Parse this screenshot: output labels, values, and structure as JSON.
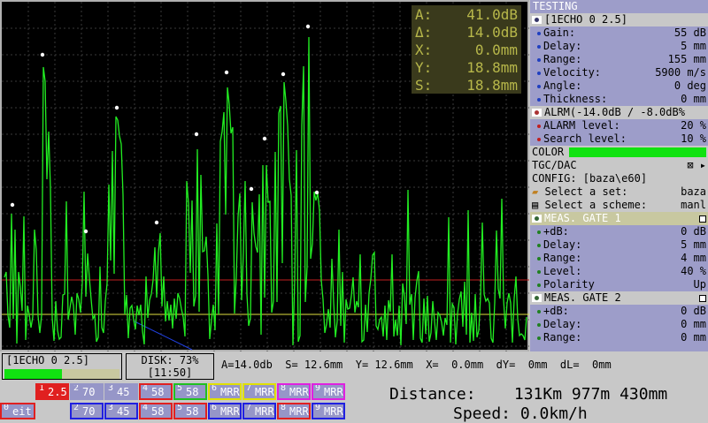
{
  "readout": [
    {
      "label": "A:",
      "value": "41.0dB"
    },
    {
      "label": "Δ:",
      "value": "14.0dB"
    },
    {
      "label": "X:",
      "value": "0.0mm"
    },
    {
      "label": "Y:",
      "value": "18.8mm"
    },
    {
      "label": "S:",
      "value": "18.8mm"
    }
  ],
  "panel": {
    "title": "TESTING",
    "echo_header": "[1ECHO 0 2.5]",
    "echo_items": [
      {
        "label": "Gain:",
        "value": "55 dB"
      },
      {
        "label": "Delay:",
        "value": "5 mm"
      },
      {
        "label": "Range:",
        "value": "155 mm"
      },
      {
        "label": "Velocity:",
        "value": "5900 m/s"
      },
      {
        "label": "Angle:",
        "value": "0 deg"
      },
      {
        "label": "Thickness:",
        "value": "0 mm"
      }
    ],
    "alarm_header": "ALRM(-14.0dB / -8.0dB%",
    "alarm_items": [
      {
        "label": "ALARM level:",
        "value": "20 %"
      },
      {
        "label": "Search level:",
        "value": "10 %"
      }
    ],
    "color_label": "COLOR",
    "tgc_label": "TGC/DAC",
    "config_label": "CONFIG: [baza\\e60]",
    "select_set": {
      "label": "Select a set:",
      "value": "baza"
    },
    "select_scheme": {
      "label": "Select a scheme:",
      "value": "manl"
    },
    "gate1_header": "MEAS. GATE 1",
    "gate1_items": [
      {
        "label": "+dB:",
        "value": "0 dB"
      },
      {
        "label": "Delay:",
        "value": "5 mm"
      },
      {
        "label": "Range:",
        "value": "4 mm"
      },
      {
        "label": "Level:",
        "value": "40 %"
      },
      {
        "label": "Polarity",
        "value": "Up"
      }
    ],
    "gate2_header": "MEAS. GATE 2",
    "gate2_items": [
      {
        "label": "+dB:",
        "value": "0 dB"
      },
      {
        "label": "Delay:",
        "value": "0 mm"
      },
      {
        "label": "Range:",
        "value": "0 mm"
      }
    ]
  },
  "status": {
    "echo_name": "[1ECHO 0 2.5]",
    "echo_level": 0.5,
    "disk": "DISK: 73%",
    "time": "[11:50]",
    "measurements": "A=14.0db  S= 12.6mm  Y= 12.6mm  X=  0.0mm  dY=  0mm  dL=  0mm"
  },
  "channels_top": [
    {
      "num": "1",
      "label": "2.5",
      "color": "#e02020",
      "fill": "#e02020"
    },
    {
      "num": "2",
      "label": "70",
      "color": "#9696c8",
      "fill": "#9696c8"
    },
    {
      "num": "3",
      "label": "45",
      "color": "#9696c8",
      "fill": "#9696c8"
    },
    {
      "num": "4",
      "label": "58",
      "color": "#e02020",
      "fill": "#9696c8"
    },
    {
      "num": "5",
      "label": "58",
      "color": "#20c020",
      "fill": "#9696c8"
    },
    {
      "num": "6",
      "label": "MRR",
      "color": "#e0e000",
      "fill": "#9696c8"
    },
    {
      "num": "7",
      "label": "MRR",
      "color": "#e0e000",
      "fill": "#9696c8"
    },
    {
      "num": "8",
      "label": "MRR",
      "color": "#e020e0",
      "fill": "#9696c8"
    },
    {
      "num": "9",
      "label": "MRR",
      "color": "#e020e0",
      "fill": "#9696c8"
    }
  ],
  "channels_bottom": [
    {
      "num": "0",
      "label": "eit",
      "color": "#e02020"
    },
    {
      "num": "2",
      "label": "70",
      "color": "#2020e0"
    },
    {
      "num": "3",
      "label": "45",
      "color": "#2020e0"
    },
    {
      "num": "4",
      "label": "58",
      "color": "#e02020"
    },
    {
      "num": "5",
      "label": "58",
      "color": "#e02020"
    },
    {
      "num": "6",
      "label": "MRR",
      "color": "#2020e0"
    },
    {
      "num": "7",
      "label": "MRR",
      "color": "#2020e0"
    },
    {
      "num": "8",
      "label": "MRR",
      "color": "#e02020"
    },
    {
      "num": "9",
      "label": "MRR",
      "color": "#2020e0"
    }
  ],
  "distance": "Distance:    131Km 977m 430mm",
  "speed": "Speed: 0.0km/h"
}
